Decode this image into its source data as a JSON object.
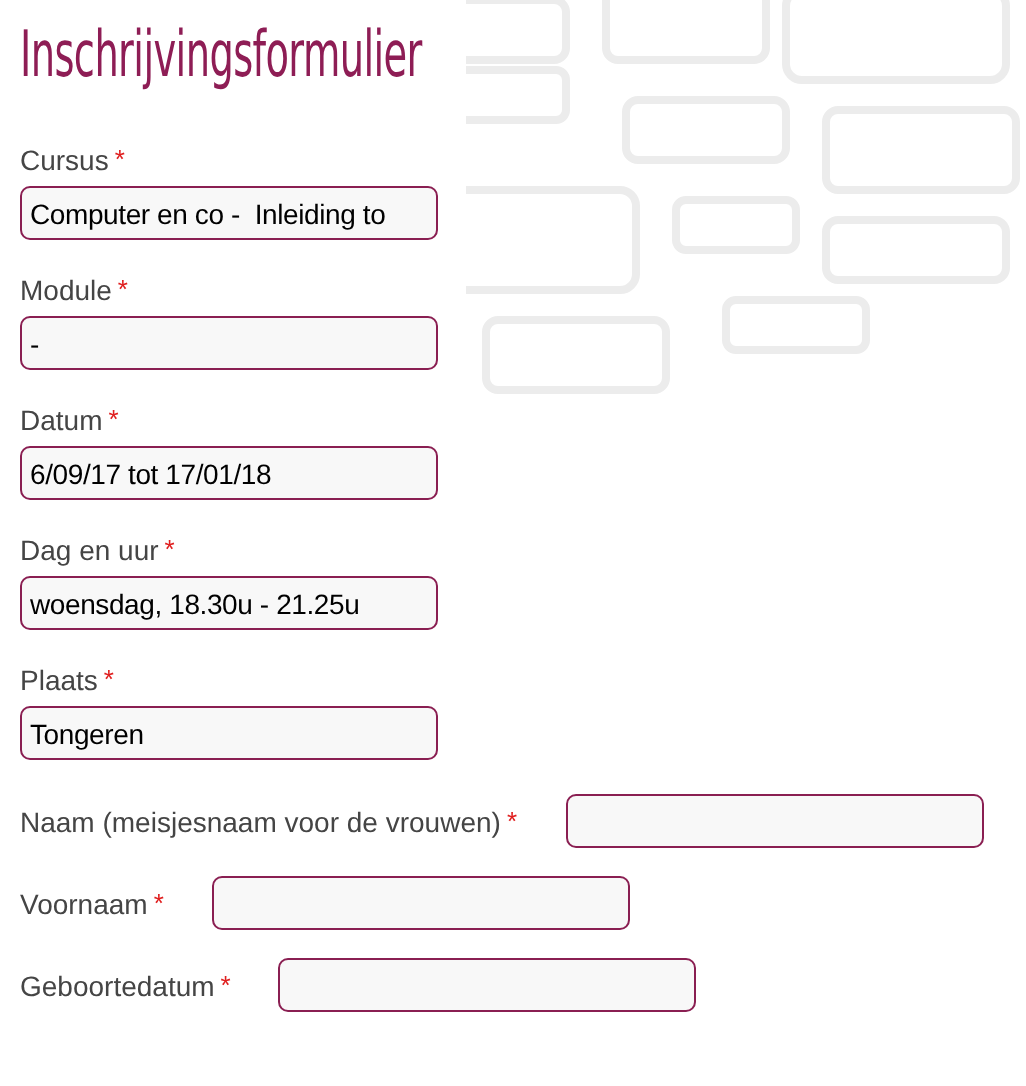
{
  "title": "Inschrijvingsformulier",
  "fields": [
    {
      "kind": "stacked",
      "label": "Cursus",
      "mark": "*",
      "value": "Computer en co -  Inleiding to"
    },
    {
      "kind": "stacked",
      "label": "Module",
      "mark": "*",
      "value": "-"
    },
    {
      "kind": "stacked",
      "label": "Datum",
      "mark": "*",
      "value": "6/09/17 tot 17/01/18"
    },
    {
      "kind": "stacked",
      "label": "Dag en uur",
      "mark": "*",
      "value": "woensdag, 18.30u - 21.25u"
    },
    {
      "kind": "stacked",
      "label": "Plaats",
      "mark": "*",
      "value": "Tongeren"
    },
    {
      "kind": "inline",
      "label": "Naam (meisjesnaam voor de vrouwen)",
      "mark": "*"
    },
    {
      "kind": "inline",
      "label": "Voornaam",
      "mark": "*"
    },
    {
      "kind": "inline",
      "label": "Geboortedatum",
      "mark": "*"
    }
  ]
}
